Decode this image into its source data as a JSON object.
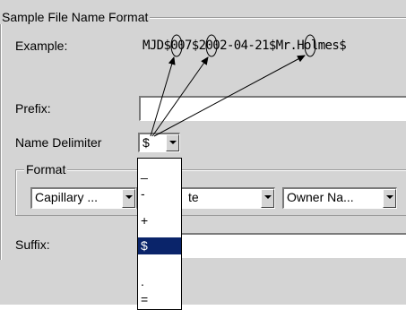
{
  "sample_group": {
    "legend": "Sample File Name Format",
    "example_label": "Example:",
    "example_value": "MJD$007$2002-04-21$Mr.Holmes$"
  },
  "prefix": {
    "label": "Prefix:",
    "value": ""
  },
  "delimiter": {
    "label": "Name Delimiter",
    "value": "$"
  },
  "format_group": {
    "legend": "Format",
    "combo1": "Capillary ...",
    "combo2": "te",
    "combo3": "Owner Na..."
  },
  "suffix": {
    "label": "Suffix:",
    "value": ""
  },
  "dropdown": {
    "options": [
      "_",
      "-",
      "+",
      "$",
      ".",
      "="
    ],
    "selected": "$"
  }
}
